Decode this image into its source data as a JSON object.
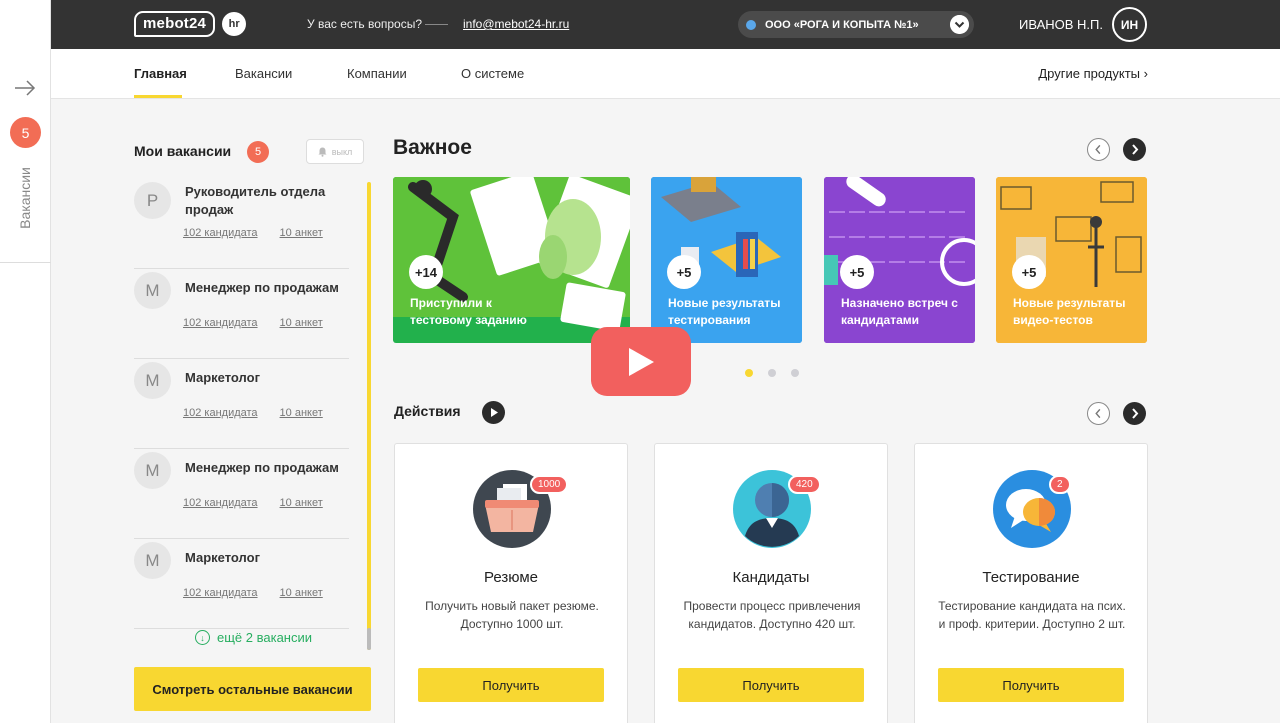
{
  "sidebar_rail": {
    "count": "5",
    "label": "Вакансии"
  },
  "header": {
    "logo": "mebot24",
    "logo_badge": "hr",
    "question": "У вас есть вопросы?",
    "email": "info@mebot24-hr.ru",
    "company": "ООО «РОГА И КОПЫТА №1»",
    "user_name": "ИВАНОВ Н.П.",
    "user_initials": "ИН"
  },
  "nav": {
    "tabs": [
      {
        "label": "Главная",
        "active": true
      },
      {
        "label": "Вакансии"
      },
      {
        "label": "Компании"
      },
      {
        "label": "О системе"
      }
    ],
    "other_products": "Другие продукты"
  },
  "my_vacancies": {
    "title": "Мои вакансии",
    "count": "5",
    "notify_toggle": "выкл",
    "items": [
      {
        "initial": "Р",
        "title": "Руководитель отдела продаж",
        "candidates": "102 кандидата",
        "forms": "10 анкет"
      },
      {
        "initial": "М",
        "title": "Менеджер по продажам",
        "candidates": "102 кандидата",
        "forms": "10 анкет"
      },
      {
        "initial": "М",
        "title": "Маркетолог",
        "candidates": "102 кандидата",
        "forms": "10 анкет"
      },
      {
        "initial": "М",
        "title": "Менеджер по продажам",
        "candidates": "102 кандидата",
        "forms": "10 анкет"
      },
      {
        "initial": "М",
        "title": "Маркетолог",
        "candidates": "102 кандидата",
        "forms": "10 анкет"
      }
    ],
    "more_link": "ещё 2 вакансии",
    "see_all_button": "Смотреть остальные вакансии"
  },
  "important": {
    "title": "Важное",
    "cards": [
      {
        "count": "+14",
        "text": "Приступили к тестовому заданию",
        "color": "#22b14c"
      },
      {
        "count": "+5",
        "text": "Новые результаты тестирования",
        "color": "#2a8ee0"
      },
      {
        "count": "+5",
        "text": "Назначено встреч с кандидатами",
        "color": "#7e3fc4"
      },
      {
        "count": "+5",
        "text": "Новые результаты видео-тестов",
        "color": "#f3a92e"
      }
    ],
    "active_page": 1,
    "pages": 3
  },
  "actions": {
    "title": "Действия",
    "cards": [
      {
        "name": "Резюме",
        "badge": "1000",
        "desc_1": "Получить новый пакет резюме.",
        "desc_2": "Доступно 1000 шт.",
        "button": "Получить"
      },
      {
        "name": "Кандидаты",
        "badge": "420",
        "desc_1": "Провести процесс привлечения",
        "desc_2": "кандидатов. Доступно 420 шт.",
        "button": "Получить"
      },
      {
        "name": "Тестирование",
        "badge": "2",
        "desc_1": "Тестирование кандидата на псих.",
        "desc_2": "и проф. критерии. Доступно 2 шт.",
        "button": "Получить"
      }
    ]
  },
  "colors": {
    "accent": "#f8d731",
    "badge": "#f26d55",
    "topbar": "#333333",
    "link_green": "#27ae60"
  }
}
